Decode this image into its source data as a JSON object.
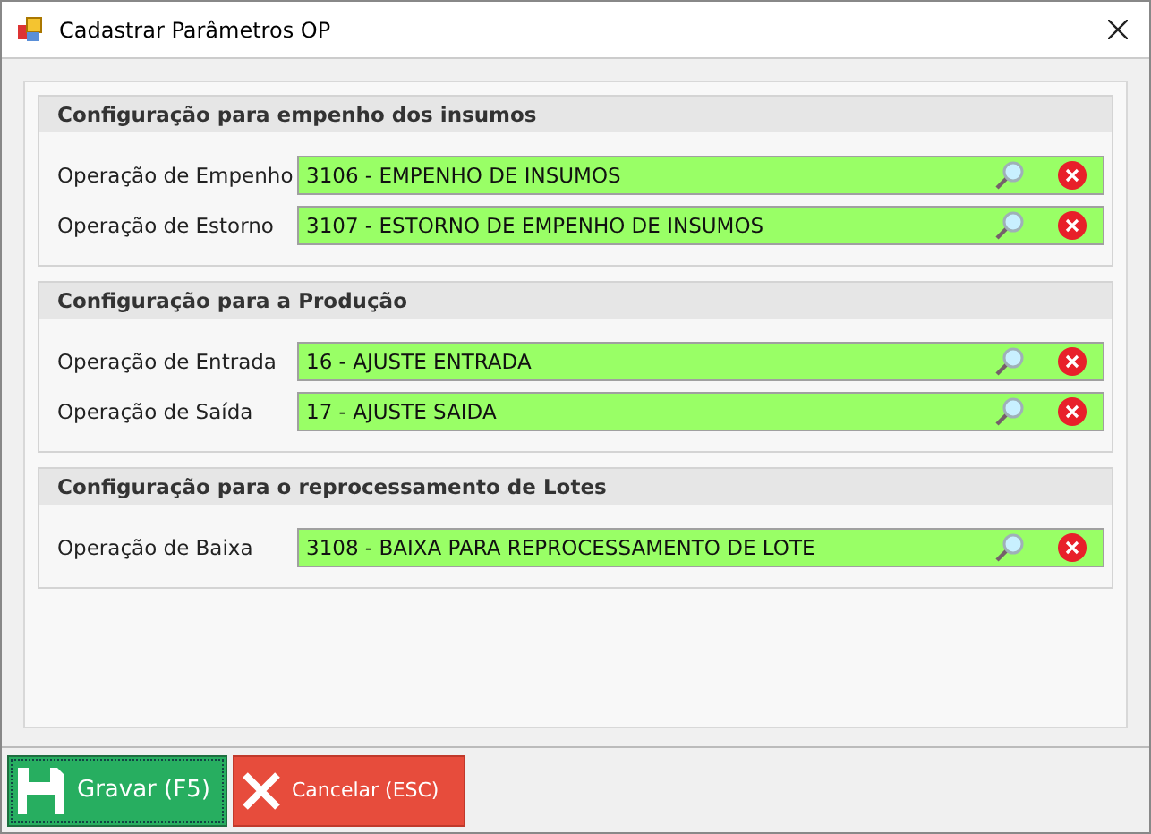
{
  "window": {
    "title": "Cadastrar Parâmetros OP"
  },
  "groups": [
    {
      "title": "Configuração para empenho dos insumos",
      "rows": [
        {
          "label": "Operação de Empenho",
          "value": "3106 - EMPENHO DE INSUMOS"
        },
        {
          "label": "Operação de Estorno",
          "value": "3107 - ESTORNO DE EMPENHO DE INSUMOS"
        }
      ]
    },
    {
      "title": "Configuração para a Produção",
      "rows": [
        {
          "label": "Operação de Entrada",
          "value": "16 - AJUSTE ENTRADA"
        },
        {
          "label": "Operação de Saída",
          "value": "17 - AJUSTE SAIDA"
        }
      ]
    },
    {
      "title": "Configuração para o reprocessamento de Lotes",
      "rows": [
        {
          "label": "Operação de Baixa",
          "value": "3108 - BAIXA PARA REPROCESSAMENTO DE LOTE"
        }
      ]
    }
  ],
  "buttons": [
    {
      "kind": "save",
      "label": "Gravar (F5)"
    },
    {
      "kind": "cancel",
      "label": "Cancelar (ESC)"
    }
  ]
}
